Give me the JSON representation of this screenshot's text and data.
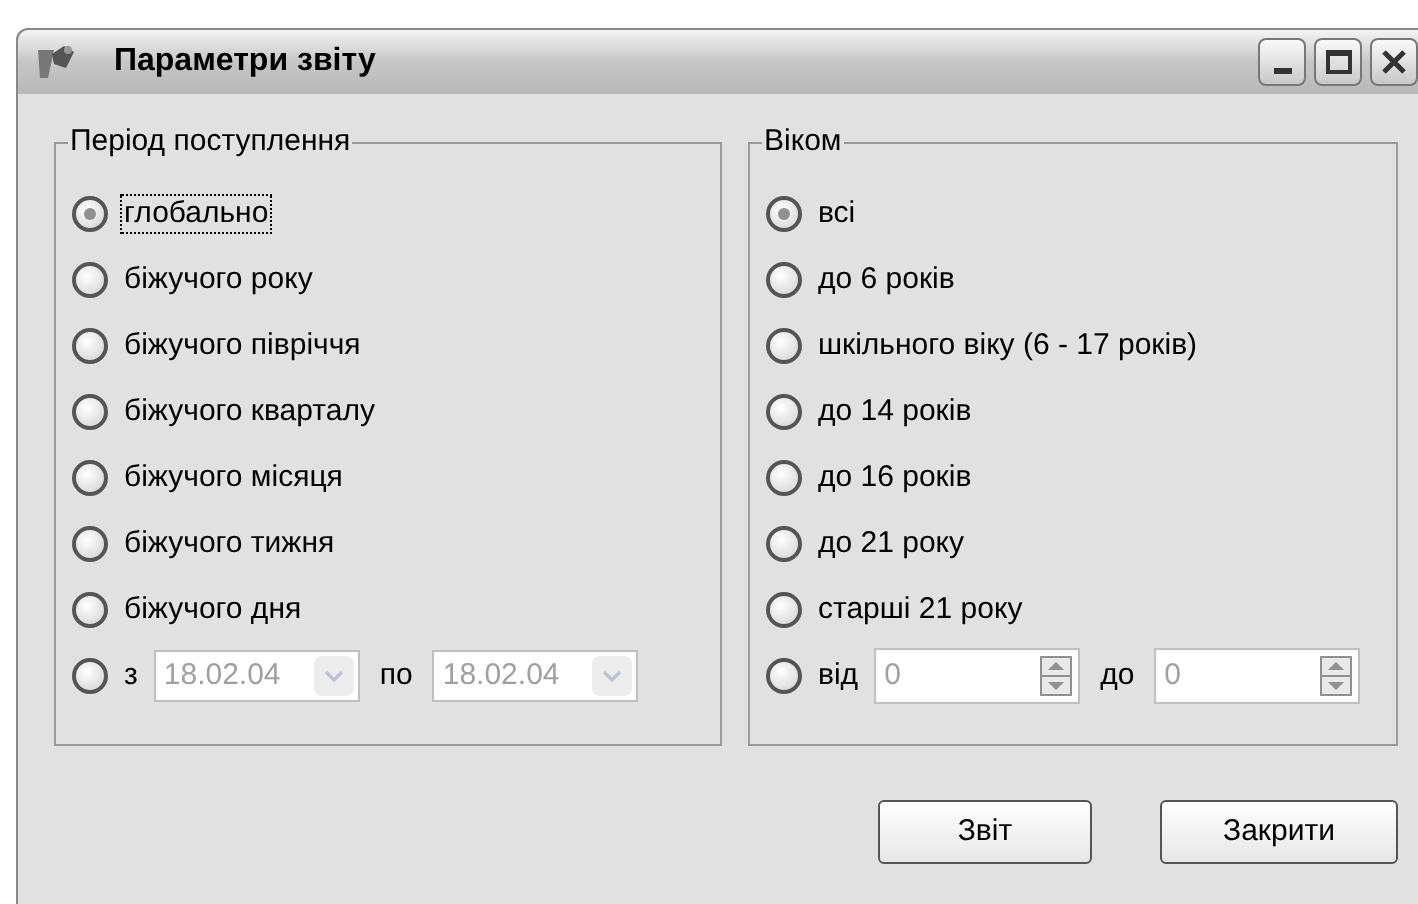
{
  "window": {
    "title": "Параметри звіту"
  },
  "period": {
    "legend": "Період поступлення",
    "options": [
      {
        "kind": "plain",
        "label": "глобально",
        "selected": true,
        "focused": true
      },
      {
        "kind": "plain",
        "label": "біжучого року",
        "selected": false,
        "focused": false
      },
      {
        "kind": "plain",
        "label": "біжучого півріччя",
        "selected": false,
        "focused": false
      },
      {
        "kind": "plain",
        "label": "біжучого кварталу",
        "selected": false,
        "focused": false
      },
      {
        "kind": "plain",
        "label": "біжучого місяця",
        "selected": false,
        "focused": false
      },
      {
        "kind": "plain",
        "label": "біжучого тижня",
        "selected": false,
        "focused": false
      },
      {
        "kind": "plain",
        "label": "біжучого дня",
        "selected": false,
        "focused": false
      },
      {
        "kind": "date_range",
        "label": "з",
        "selected": false,
        "focused": false,
        "from": {
          "value": "18.02.04",
          "disabled": true
        },
        "to_label": "по",
        "to": {
          "value": "18.02.04",
          "disabled": true
        }
      }
    ]
  },
  "age": {
    "legend": "Віком",
    "options": [
      {
        "kind": "plain",
        "label": "всі",
        "selected": true
      },
      {
        "kind": "plain",
        "label": "до 6 років",
        "selected": false
      },
      {
        "kind": "plain",
        "label": "шкільного віку (6 - 17 років)",
        "selected": false
      },
      {
        "kind": "plain",
        "label": "до 14 років",
        "selected": false
      },
      {
        "kind": "plain",
        "label": "до 16 років",
        "selected": false
      },
      {
        "kind": "plain",
        "label": "до 21 року",
        "selected": false
      },
      {
        "kind": "plain",
        "label": "старші 21 року",
        "selected": false
      },
      {
        "kind": "spin_range",
        "label": "від",
        "selected": false,
        "from": {
          "value": "0",
          "disabled": true
        },
        "to_label": "до",
        "to": {
          "value": "0",
          "disabled": true
        }
      }
    ]
  },
  "buttons": [
    {
      "label": "Звіт"
    },
    {
      "label": "Закрити"
    }
  ]
}
